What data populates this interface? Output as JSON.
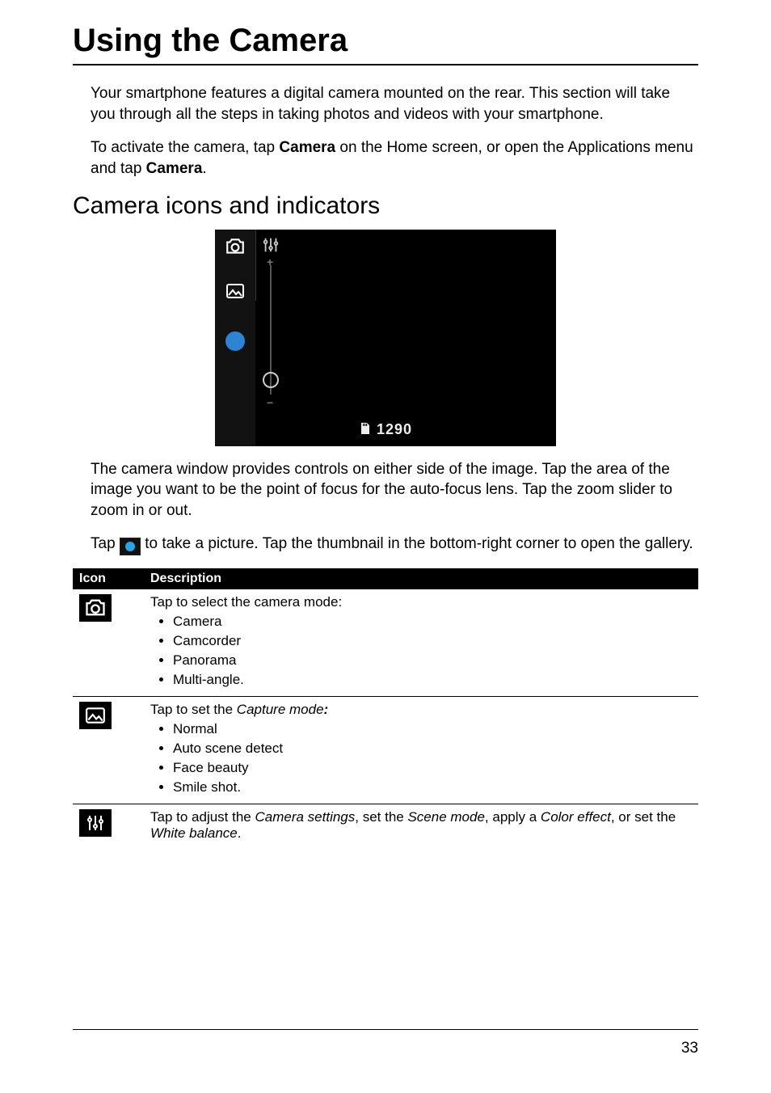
{
  "title": "Using the Camera",
  "intro_p1": "Your smartphone features a digital camera mounted on the rear. This section will take you through all the steps in taking photos and videos with your smartphone.",
  "intro_p2_a": "To activate the camera, tap ",
  "intro_p2_bold1": "Camera",
  "intro_p2_b": " on the Home screen, or open the Applications menu and tap ",
  "intro_p2_bold2": "Camera",
  "intro_p2_c": ".",
  "section_heading": "Camera icons and indicators",
  "camera_ui": {
    "sd_count": "1290",
    "zoom_plus": "+",
    "zoom_minus": "−"
  },
  "after_figure_p1": "The camera window provides controls on either side of the image. Tap the area of the image you want to be the point of focus for the auto-focus lens. Tap the zoom slider to zoom in or out.",
  "after_figure_p2_a": "Tap ",
  "after_figure_p2_b": " to take a picture. Tap the thumbnail in the bottom-right corner to open the gallery.",
  "table": {
    "headers": {
      "icon": "Icon",
      "desc": "Description"
    },
    "rows": [
      {
        "icon_name": "camera-icon",
        "lead": "Tap to select the camera mode:",
        "bullets": [
          "Camera",
          "Camcorder",
          "Panorama",
          "Multi-angle."
        ]
      },
      {
        "icon_name": "picture-icon",
        "lead_a": "Tap to set the ",
        "lead_italic": "Capture mode",
        "lead_boldcolon": ":",
        "bullets": [
          "Normal",
          "Auto scene detect",
          "Face beauty",
          "Smile shot."
        ]
      },
      {
        "icon_name": "sliders-icon",
        "lead_a": "Tap to adjust the ",
        "i1": "Camera settings",
        "m1": ", set the ",
        "i2": "Scene mode",
        "m2": ", apply a ",
        "i3": "Color effect",
        "m3": ", or set the ",
        "i4": "White balance",
        "m4": "."
      }
    ]
  },
  "page_number": "33"
}
